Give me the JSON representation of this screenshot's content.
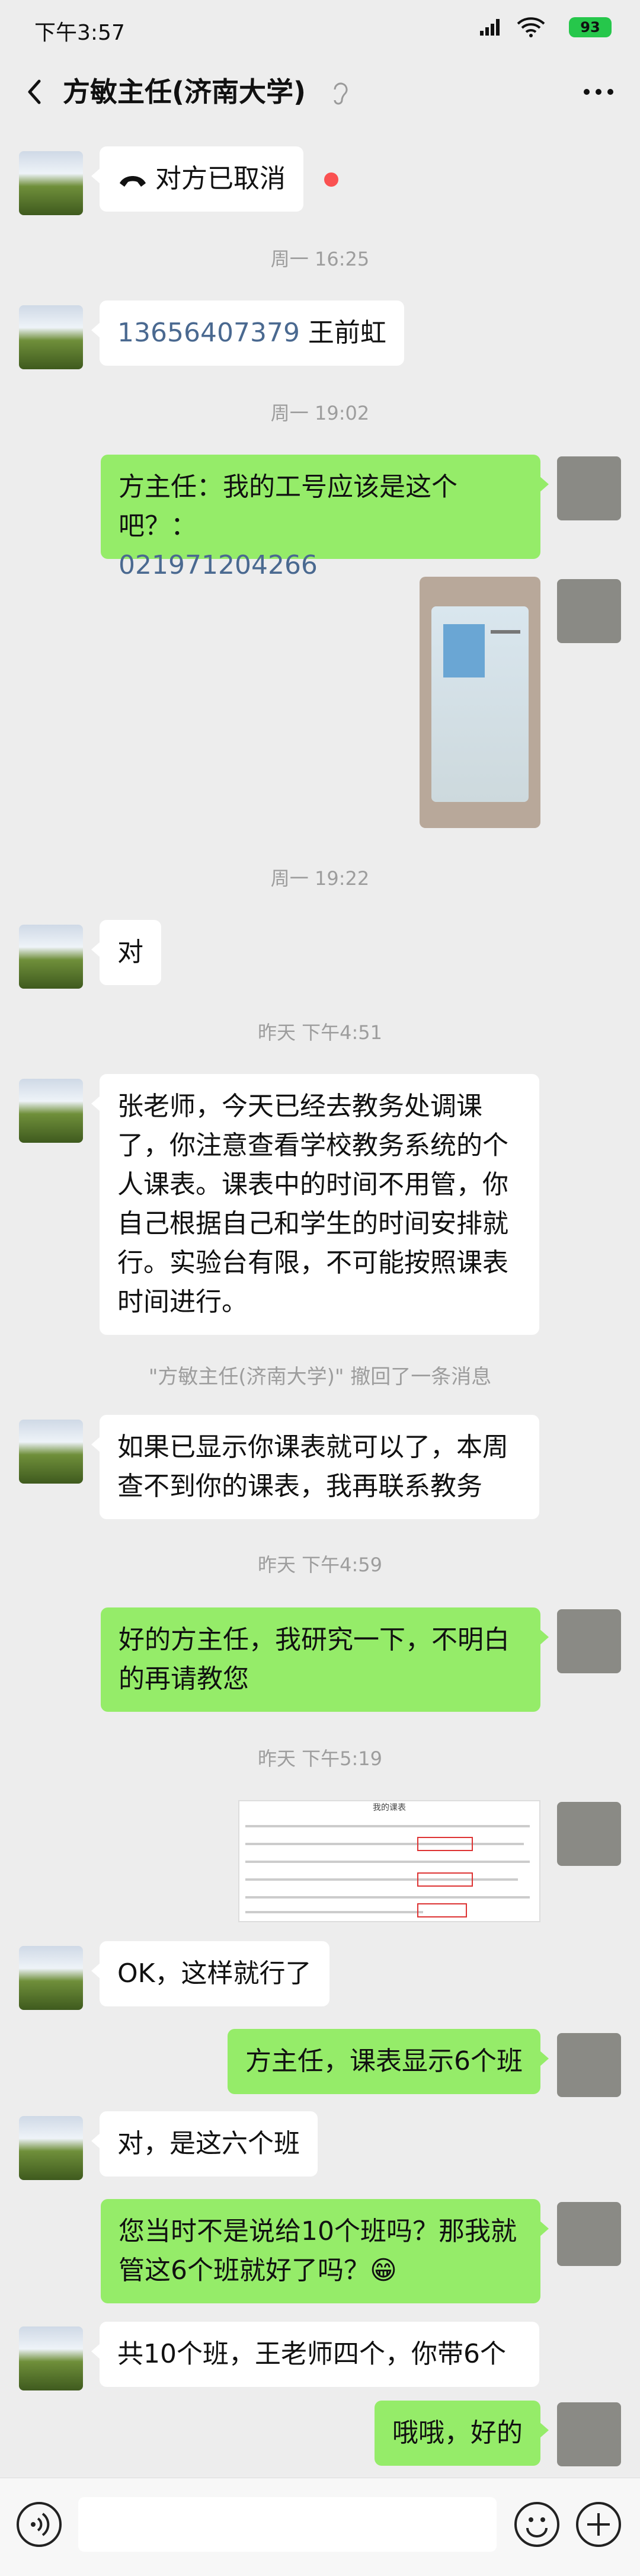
{
  "status_bar": {
    "time": "下午3:57",
    "battery": "93"
  },
  "header": {
    "title": "方敏主任(济南大学)"
  },
  "messages": {
    "m1": {
      "icon": "phone-hangup-icon",
      "text": "对方已取消"
    },
    "ts1": "周一 16:25",
    "m2_link": "13656407379",
    "m2_text": " 王前虹",
    "ts2": "周一 19:02",
    "m3_text": "方主任：我的工号应该是这个吧？：",
    "m3_link": "021971204266",
    "ts3": "周一 19:22",
    "m5": "对",
    "ts4": "昨天 下午4:51",
    "m6": "张老师，今天已经去教务处调课了，你注意查看学校教务系统的个人课表。课表中的时间不用管，你自己根据自己和学生的时间安排就行。实验台有限，不可能按照课表时间进行。",
    "recall": "\"方敏主任(济南大学)\" 撤回了一条消息",
    "m7": "如果已显示你课表就可以了，本周查不到你的课表，我再联系教务",
    "ts5": "昨天 下午4:59",
    "m8": "好的方主任，我研究一下，不明白的再请教您",
    "ts6": "昨天 下午5:19",
    "m9_caption": "我的课表",
    "m10": "OK，这样就行了",
    "m11": "方主任，课表显示6个班",
    "m12": "对，是这六个班",
    "m13": "您当时不是说给10个班吗？那我就管这6个班就好了吗？😁",
    "m14": "共10个班，王老师四个，你带6个",
    "m15": "哦哦，好的"
  },
  "colors": {
    "incoming_bubble": "#ffffff",
    "outgoing_bubble": "#95ec69",
    "background": "#ededed",
    "link": "#4a6990"
  }
}
